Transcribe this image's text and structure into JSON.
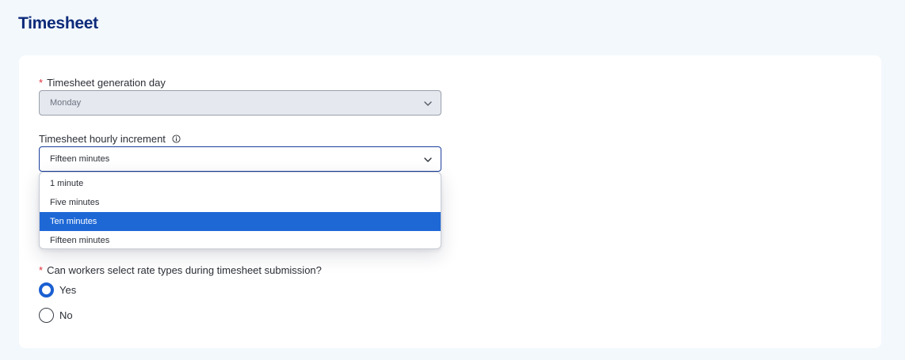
{
  "header": {
    "title": "Timesheet"
  },
  "form": {
    "generation_day": {
      "label": "Timesheet generation day",
      "required_mark": "*",
      "value": "Monday",
      "icon": "chevron-down-icon"
    },
    "hourly_increment": {
      "label": "Timesheet hourly increment",
      "info_icon": "info-icon",
      "value": "Fifteen minutes",
      "icon": "chevron-down-icon",
      "options": [
        {
          "label": "1 minute",
          "highlighted": false
        },
        {
          "label": "Five minutes",
          "highlighted": false
        },
        {
          "label": "Ten minutes",
          "highlighted": true
        },
        {
          "label": "Fifteen minutes",
          "highlighted": false
        }
      ]
    },
    "rate_types": {
      "label": "Can workers select rate types during timesheet submission?",
      "required_mark": "*",
      "options": [
        {
          "label": "Yes",
          "checked": true
        },
        {
          "label": "No",
          "checked": false
        }
      ]
    }
  },
  "colors": {
    "title": "#0d2a7a",
    "required": "#e0313b",
    "highlight": "#1e68d6",
    "radio_checked": "#1b5fd1",
    "focus_border": "#1b3f9c"
  }
}
